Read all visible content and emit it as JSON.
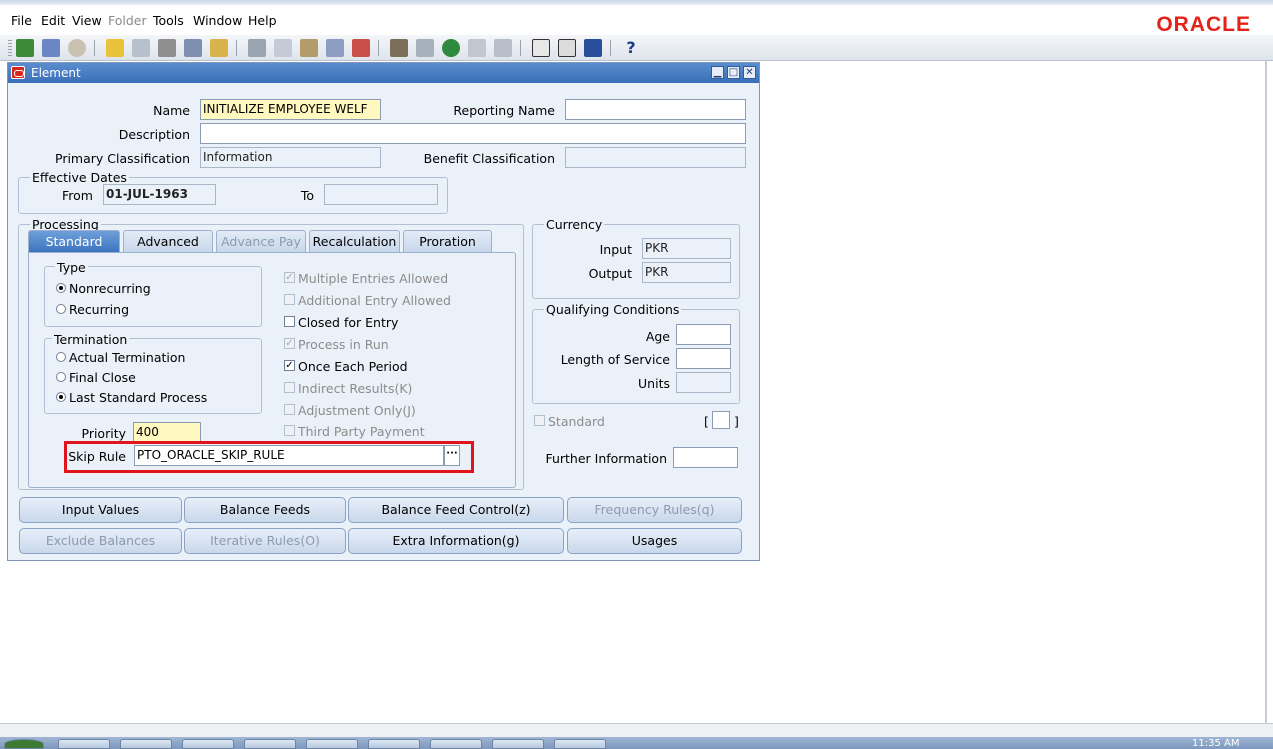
{
  "menu": [
    {
      "label": "File",
      "enabled": true
    },
    {
      "label": "Edit",
      "enabled": true
    },
    {
      "label": "View",
      "enabled": true
    },
    {
      "label": "Folder",
      "enabled": false
    },
    {
      "label": "Tools",
      "enabled": true
    },
    {
      "label": "Window",
      "enabled": true
    },
    {
      "label": "Help",
      "enabled": true
    }
  ],
  "brand": {
    "logo_text": "ORACLE",
    "color": "#e2231a"
  },
  "toolbar_icons": [
    "new-icon",
    "find-icon",
    "navigator-icon",
    "save-icon",
    "next-step-icon",
    "switch-responsibility-icon",
    "print-icon",
    "close-form-icon",
    "cut-icon",
    "copy-icon",
    "paste-icon",
    "new-record-icon",
    "delete-record-icon",
    "edit-field-icon",
    "zoom-icon",
    "translations-icon",
    "attachments-icon",
    "folder-tools-icon",
    "calendar-icon",
    "schedule-icon",
    "exit-icon",
    "help-icon"
  ],
  "window": {
    "title": "Element",
    "min": "▁",
    "max": "□",
    "close": "✕"
  },
  "header": {
    "name_label": "Name",
    "name_value": "INITIALIZE EMPLOYEE WELF",
    "reporting_name_label": "Reporting Name",
    "reporting_name_value": "",
    "description_label": "Description",
    "description_value": "",
    "primary_class_label": "Primary Classification",
    "primary_class_value": "Information",
    "benefit_class_label": "Benefit Classification",
    "benefit_class_value": ""
  },
  "effective_dates": {
    "title": "Effective Dates",
    "from_label": "From",
    "from_value": "01-JUL-1963",
    "to_label": "To",
    "to_value": ""
  },
  "processing": {
    "title": "Processing",
    "tabs": [
      {
        "label": "Standard",
        "active": true,
        "enabled": true
      },
      {
        "label": "Advanced",
        "active": false,
        "enabled": true
      },
      {
        "label": "Advance Pay",
        "active": false,
        "enabled": false
      },
      {
        "label": "Recalculation",
        "active": false,
        "enabled": true
      },
      {
        "label": "Proration",
        "active": false,
        "enabled": true
      }
    ],
    "type_title": "Type",
    "type_options": [
      {
        "label": "Nonrecurring",
        "selected": true
      },
      {
        "label": "Recurring",
        "selected": false
      }
    ],
    "termination_title": "Termination",
    "termination_options": [
      {
        "label": "Actual Termination",
        "selected": false
      },
      {
        "label": "Final Close",
        "selected": false
      },
      {
        "label": "Last Standard Process",
        "selected": true
      }
    ],
    "checkboxes": [
      {
        "label": "Multiple Entries Allowed",
        "checked": true,
        "enabled": false
      },
      {
        "label": "Additional Entry Allowed",
        "checked": false,
        "enabled": false
      },
      {
        "label": "Closed for Entry",
        "checked": false,
        "enabled": true
      },
      {
        "label": "Process in Run",
        "checked": true,
        "enabled": false
      },
      {
        "label": "Once Each Period",
        "checked": true,
        "enabled": true
      },
      {
        "label": "Indirect Results(K)",
        "checked": false,
        "enabled": false
      },
      {
        "label": "Adjustment Only(J)",
        "checked": false,
        "enabled": false
      },
      {
        "label": "Third Party Payment",
        "checked": false,
        "enabled": false
      }
    ],
    "priority_label": "Priority",
    "priority_value": "400",
    "skip_rule_label": "Skip Rule",
    "skip_rule_value": "PTO_ORACLE_SKIP_RULE",
    "lov_glyph": "···"
  },
  "currency": {
    "title": "Currency",
    "input_label": "Input",
    "input_value": "PKR",
    "output_label": "Output",
    "output_value": "PKR"
  },
  "qualifying": {
    "title": "Qualifying Conditions",
    "age_label": "Age",
    "age_value": "",
    "los_label": "Length of Service",
    "los_value": "",
    "units_label": "Units",
    "units_value": ""
  },
  "standard": {
    "label": "Standard",
    "checked": false,
    "enabled": false,
    "flex_open": "[",
    "flex_close": "]"
  },
  "further_info": {
    "label": "Further Information",
    "value": ""
  },
  "buttons": [
    {
      "label": "Input Values",
      "enabled": true
    },
    {
      "label": "Balance Feeds",
      "enabled": true
    },
    {
      "label": "Balance Feed Control(z)",
      "enabled": true
    },
    {
      "label": "Frequency Rules(q)",
      "enabled": false
    },
    {
      "label": "Exclude Balances",
      "enabled": false
    },
    {
      "label": "Iterative Rules(O)",
      "enabled": false
    },
    {
      "label": "Extra Information(g)",
      "enabled": true
    },
    {
      "label": "Usages",
      "enabled": true
    }
  ],
  "clock": "11:35 AM"
}
